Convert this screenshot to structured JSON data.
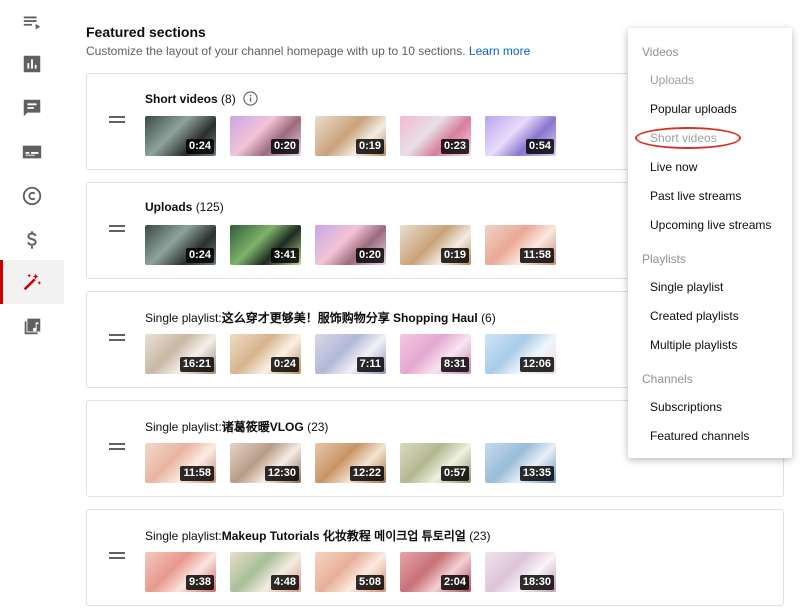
{
  "header": {
    "title": "Featured sections",
    "subtitle": "Customize the layout of your channel homepage with up to 10 sections.",
    "learn_more": "Learn more"
  },
  "rail_icons": [
    "playlist-icon",
    "analytics-icon",
    "comments-icon",
    "subtitles-icon",
    "copyright-icon",
    "monetization-icon",
    "customization-icon",
    "audio-library-icon"
  ],
  "sections": [
    {
      "prefix": "",
      "name": "Short videos",
      "count": "(8)",
      "durations": [
        "0:24",
        "0:20",
        "0:19",
        "0:23",
        "0:54"
      ]
    },
    {
      "prefix": "",
      "name": "Uploads",
      "count": "(125)",
      "durations": [
        "0:24",
        "3:41",
        "0:20",
        "0:19",
        "11:58"
      ]
    },
    {
      "prefix": "Single playlist: ",
      "name": "这么穿才更够美！服饰购物分享 Shopping Haul",
      "count": "(6)",
      "durations": [
        "16:21",
        "0:24",
        "7:11",
        "8:31",
        "12:06"
      ]
    },
    {
      "prefix": "Single playlist: ",
      "name": "诸葛筱暖VLOG",
      "count": "(23)",
      "durations": [
        "11:58",
        "12:30",
        "12:22",
        "0:57",
        "13:35"
      ]
    },
    {
      "prefix": "Single playlist: ",
      "name": "Makeup Tutorials 化妆教程 메이크업 튜토리얼",
      "count": "(23)",
      "durations": [
        "9:38",
        "4:48",
        "5:08",
        "2:04",
        "18:30"
      ]
    }
  ],
  "menu": {
    "videos_label": "Videos",
    "uploads": "Uploads",
    "popular_uploads": "Popular uploads",
    "short_videos": "Short videos",
    "live_now": "Live now",
    "past_live": "Past live streams",
    "upcoming_live": "Upcoming live streams",
    "playlists_label": "Playlists",
    "single_playlist": "Single playlist",
    "created_playlists": "Created playlists",
    "multiple_playlists": "Multiple playlists",
    "channels_label": "Channels",
    "subscriptions": "Subscriptions",
    "featured_channels": "Featured channels"
  },
  "colors": {
    "accent_red": "#cc0000",
    "link_blue": "#065fd4",
    "annotation_red": "#d93025"
  }
}
